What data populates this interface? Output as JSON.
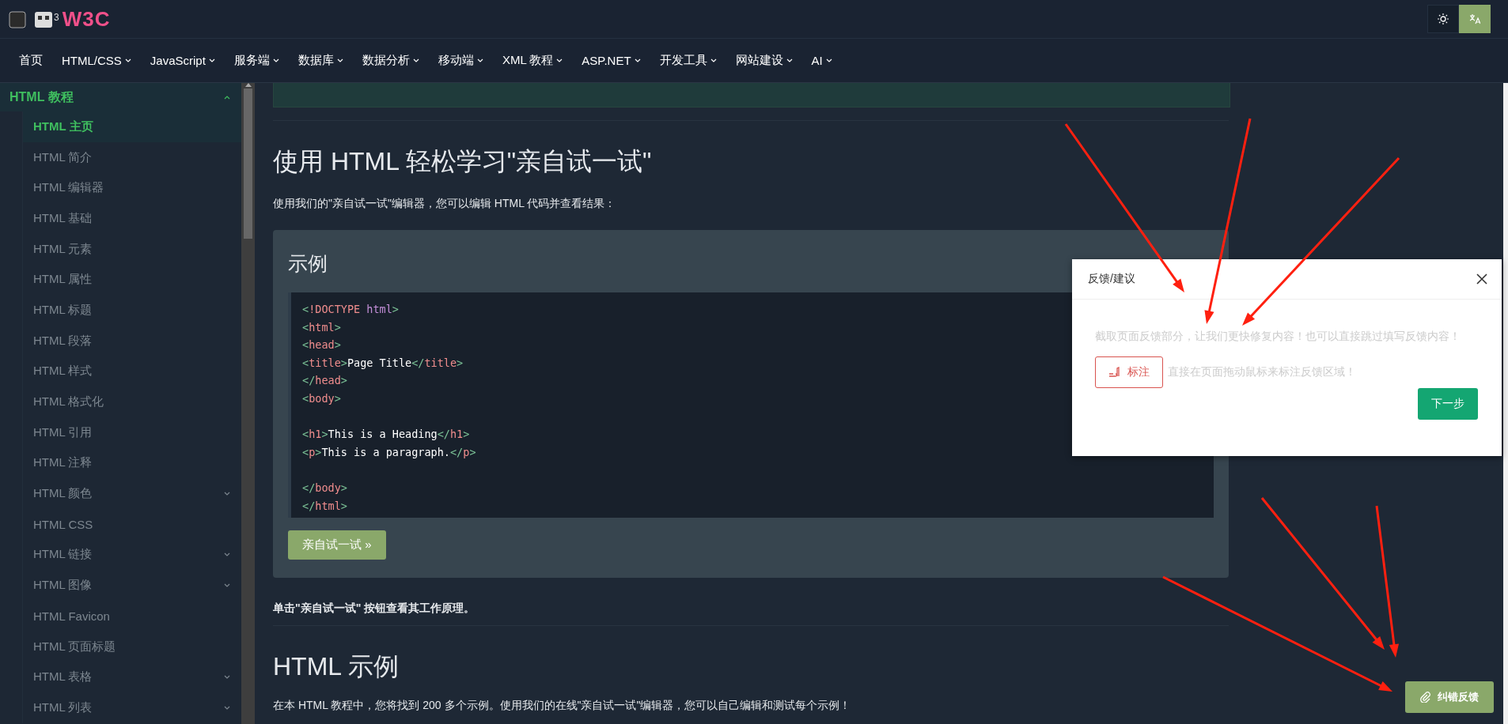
{
  "logo": {
    "badge": "3",
    "text": "W3C"
  },
  "nav": [
    {
      "label": "首页",
      "has_menu": false
    },
    {
      "label": "HTML/CSS",
      "has_menu": true
    },
    {
      "label": "JavaScript",
      "has_menu": true
    },
    {
      "label": "服务端",
      "has_menu": true
    },
    {
      "label": "数据库",
      "has_menu": true
    },
    {
      "label": "数据分析",
      "has_menu": true
    },
    {
      "label": "移动端",
      "has_menu": true
    },
    {
      "label": "XML 教程",
      "has_menu": true
    },
    {
      "label": "ASP.NET",
      "has_menu": true
    },
    {
      "label": "开发工具",
      "has_menu": true
    },
    {
      "label": "网站建设",
      "has_menu": true
    },
    {
      "label": "AI",
      "has_menu": true
    }
  ],
  "sidebar": {
    "section": {
      "label": "HTML 教程",
      "expanded": true
    },
    "items": [
      {
        "label": "HTML 主页",
        "selected": true,
        "expandable": false
      },
      {
        "label": "HTML 简介",
        "selected": false,
        "expandable": false
      },
      {
        "label": "HTML 编辑器",
        "selected": false,
        "expandable": false
      },
      {
        "label": "HTML 基础",
        "selected": false,
        "expandable": false
      },
      {
        "label": "HTML 元素",
        "selected": false,
        "expandable": false
      },
      {
        "label": "HTML 属性",
        "selected": false,
        "expandable": false
      },
      {
        "label": "HTML 标题",
        "selected": false,
        "expandable": false
      },
      {
        "label": "HTML 段落",
        "selected": false,
        "expandable": false
      },
      {
        "label": "HTML 样式",
        "selected": false,
        "expandable": false
      },
      {
        "label": "HTML 格式化",
        "selected": false,
        "expandable": false
      },
      {
        "label": "HTML 引用",
        "selected": false,
        "expandable": false
      },
      {
        "label": "HTML 注释",
        "selected": false,
        "expandable": false
      },
      {
        "label": "HTML 颜色",
        "selected": false,
        "expandable": true
      },
      {
        "label": "HTML CSS",
        "selected": false,
        "expandable": false
      },
      {
        "label": "HTML 链接",
        "selected": false,
        "expandable": true
      },
      {
        "label": "HTML 图像",
        "selected": false,
        "expandable": true
      },
      {
        "label": "HTML Favicon",
        "selected": false,
        "expandable": false
      },
      {
        "label": "HTML 页面标题",
        "selected": false,
        "expandable": false
      },
      {
        "label": "HTML 表格",
        "selected": false,
        "expandable": true
      },
      {
        "label": "HTML 列表",
        "selected": false,
        "expandable": true
      }
    ]
  },
  "content": {
    "heading": "使用 HTML 轻松学习\"亲自试一试\"",
    "intro": "使用我们的\"亲自试一试\"编辑器，您可以编辑 HTML 代码并查看结果：",
    "example": {
      "title": "示例",
      "code": [
        {
          "kind": "code",
          "tokens": [
            {
              "kind": "punct",
              "text": "<"
            },
            {
              "kind": "tag",
              "text": "!DOCTYPE "
            },
            {
              "kind": "attr",
              "text": "html"
            },
            {
              "kind": "punct",
              "text": ">"
            }
          ]
        },
        {
          "kind": "code",
          "tokens": [
            {
              "kind": "punct",
              "text": "<"
            },
            {
              "kind": "tag",
              "text": "html"
            },
            {
              "kind": "punct",
              "text": ">"
            }
          ]
        },
        {
          "kind": "code",
          "tokens": [
            {
              "kind": "punct",
              "text": "<"
            },
            {
              "kind": "tag",
              "text": "head"
            },
            {
              "kind": "punct",
              "text": ">"
            }
          ]
        },
        {
          "kind": "code",
          "tokens": [
            {
              "kind": "punct",
              "text": "<"
            },
            {
              "kind": "tag",
              "text": "title"
            },
            {
              "kind": "punct",
              "text": ">"
            },
            {
              "kind": "text",
              "text": "Page Title"
            },
            {
              "kind": "punct",
              "text": "</"
            },
            {
              "kind": "tag",
              "text": "title"
            },
            {
              "kind": "punct",
              "text": ">"
            }
          ]
        },
        {
          "kind": "code",
          "tokens": [
            {
              "kind": "punct",
              "text": "</"
            },
            {
              "kind": "tag",
              "text": "head"
            },
            {
              "kind": "punct",
              "text": ">"
            }
          ]
        },
        {
          "kind": "code",
          "tokens": [
            {
              "kind": "punct",
              "text": "<"
            },
            {
              "kind": "tag",
              "text": "body"
            },
            {
              "kind": "punct",
              "text": ">"
            }
          ]
        },
        {
          "kind": "blank"
        },
        {
          "kind": "code",
          "tokens": [
            {
              "kind": "punct",
              "text": "<"
            },
            {
              "kind": "tag",
              "text": "h1"
            },
            {
              "kind": "punct",
              "text": ">"
            },
            {
              "kind": "text",
              "text": "This is a Heading"
            },
            {
              "kind": "punct",
              "text": "</"
            },
            {
              "kind": "tag",
              "text": "h1"
            },
            {
              "kind": "punct",
              "text": ">"
            }
          ]
        },
        {
          "kind": "code",
          "tokens": [
            {
              "kind": "punct",
              "text": "<"
            },
            {
              "kind": "tag",
              "text": "p"
            },
            {
              "kind": "punct",
              "text": ">"
            },
            {
              "kind": "text",
              "text": "This is a paragraph."
            },
            {
              "kind": "punct",
              "text": "</"
            },
            {
              "kind": "tag",
              "text": "p"
            },
            {
              "kind": "punct",
              "text": ">"
            }
          ]
        },
        {
          "kind": "blank"
        },
        {
          "kind": "code",
          "tokens": [
            {
              "kind": "punct",
              "text": "</"
            },
            {
              "kind": "tag",
              "text": "body"
            },
            {
              "kind": "punct",
              "text": ">"
            }
          ]
        },
        {
          "kind": "code",
          "tokens": [
            {
              "kind": "punct",
              "text": "</"
            },
            {
              "kind": "tag",
              "text": "html"
            },
            {
              "kind": "punct",
              "text": ">"
            }
          ]
        }
      ],
      "button": "亲自试一试 »"
    },
    "note": "单击\"亲自试一试\" 按钮查看其工作原理。",
    "heading2": "HTML 示例",
    "paragraph": "在本 HTML 教程中，您将找到 200 多个示例。使用我们的在线\"亲自试一试\"编辑器，您可以自己编辑和测试每个示例！"
  },
  "dialog": {
    "title": "反馈/建议",
    "hint": "截取页面反馈部分，让我们更快修复内容！也可以直接跳过填写反馈内容！",
    "mark_button": "标注",
    "mark_hint": "直接在页面拖动鼠标来标注反馈区域！",
    "next_button": "下一步"
  },
  "feedback_button": "纠错反馈"
}
